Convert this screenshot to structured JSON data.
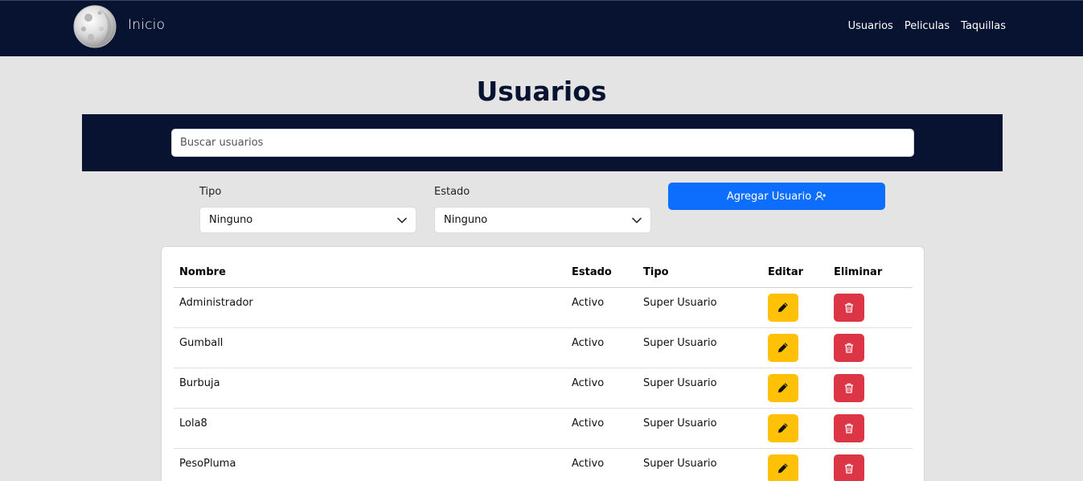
{
  "navbar": {
    "brand": "Inicio",
    "links": [
      "Usuarios",
      "Peliculas",
      "Taquillas"
    ]
  },
  "page": {
    "title": "Usuarios"
  },
  "search": {
    "placeholder": "Buscar usuarios"
  },
  "filters": {
    "tipo": {
      "label": "Tipo",
      "value": "Ninguno"
    },
    "estado": {
      "label": "Estado",
      "value": "Ninguno"
    }
  },
  "actions": {
    "add_label": "Agregar Usuario"
  },
  "table": {
    "headers": [
      "Nombre",
      "Estado",
      "Tipo",
      "Editar",
      "Eliminar"
    ],
    "rows": [
      {
        "nombre": "Administrador",
        "estado": "Activo",
        "tipo": "Super Usuario"
      },
      {
        "nombre": "Gumball",
        "estado": "Activo",
        "tipo": "Super Usuario"
      },
      {
        "nombre": "Burbuja",
        "estado": "Activo",
        "tipo": "Super Usuario"
      },
      {
        "nombre": "Lola8",
        "estado": "Activo",
        "tipo": "Super Usuario"
      },
      {
        "nombre": "PesoPluma",
        "estado": "Activo",
        "tipo": "Super Usuario"
      }
    ]
  },
  "colors": {
    "navy": "#071330",
    "primary": "#0d6efd",
    "warning": "#ffc107",
    "danger": "#dc3545",
    "background": "#e4e4e4"
  },
  "icons": {
    "logo": "moon-logo-icon",
    "add": "user-plus-icon",
    "edit": "pencil-icon",
    "delete": "trash-icon",
    "select": "chevron-down-icon"
  }
}
